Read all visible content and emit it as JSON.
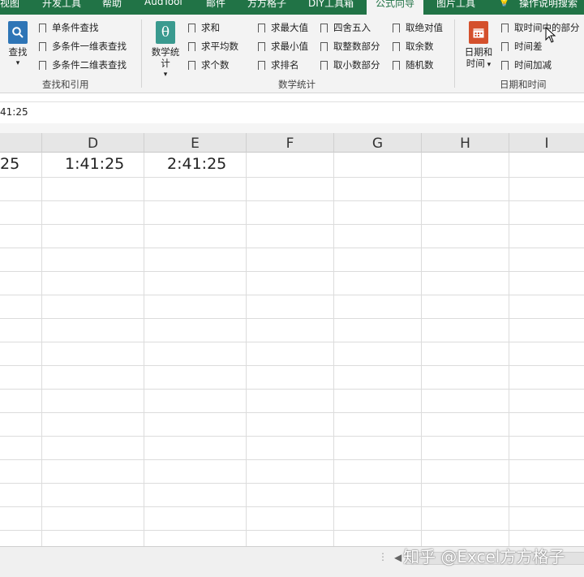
{
  "tabs": [
    "视图",
    "开发工具",
    "帮助",
    "AudTool",
    "邮件",
    "方方格子",
    "DIY工具箱",
    "公式向导",
    "图片工具",
    "操作说明搜索"
  ],
  "active_tab": "公式向导",
  "ribbon": {
    "lookup": {
      "big_label": "查找",
      "items": [
        "单条件查找",
        "多条件一维表查找",
        "多条件二维表查找"
      ],
      "group": "查找和引用"
    },
    "stats": {
      "big_label": "数学统计",
      "col1": [
        "求和",
        "求平均数",
        "求个数"
      ],
      "col2": [
        "求最大值",
        "求最小值",
        "求排名"
      ],
      "col3": [
        "四舍五入",
        "取整数部分",
        "取小数部分"
      ],
      "col4": [
        "取绝对值",
        "取余数",
        "随机数"
      ],
      "group": "数学统计"
    },
    "datetime": {
      "big_label_1": "日期和",
      "big_label_2": "时间",
      "items": [
        "取时间中的部分",
        "时间差",
        "时间加减"
      ],
      "group": "日期和时间"
    }
  },
  "formula_value": "41:25",
  "columns": [
    "D",
    "E",
    "F",
    "G",
    "H",
    "I"
  ],
  "cells": {
    "c": "25",
    "d": "1:41:25",
    "e": "2:41:25"
  },
  "watermark": "知乎 @Excel方方格子",
  "colors": {
    "accent": "#217346",
    "icon_blue": "#2e75b6",
    "icon_teal": "#3a9a8f",
    "icon_red": "#d4502c"
  }
}
